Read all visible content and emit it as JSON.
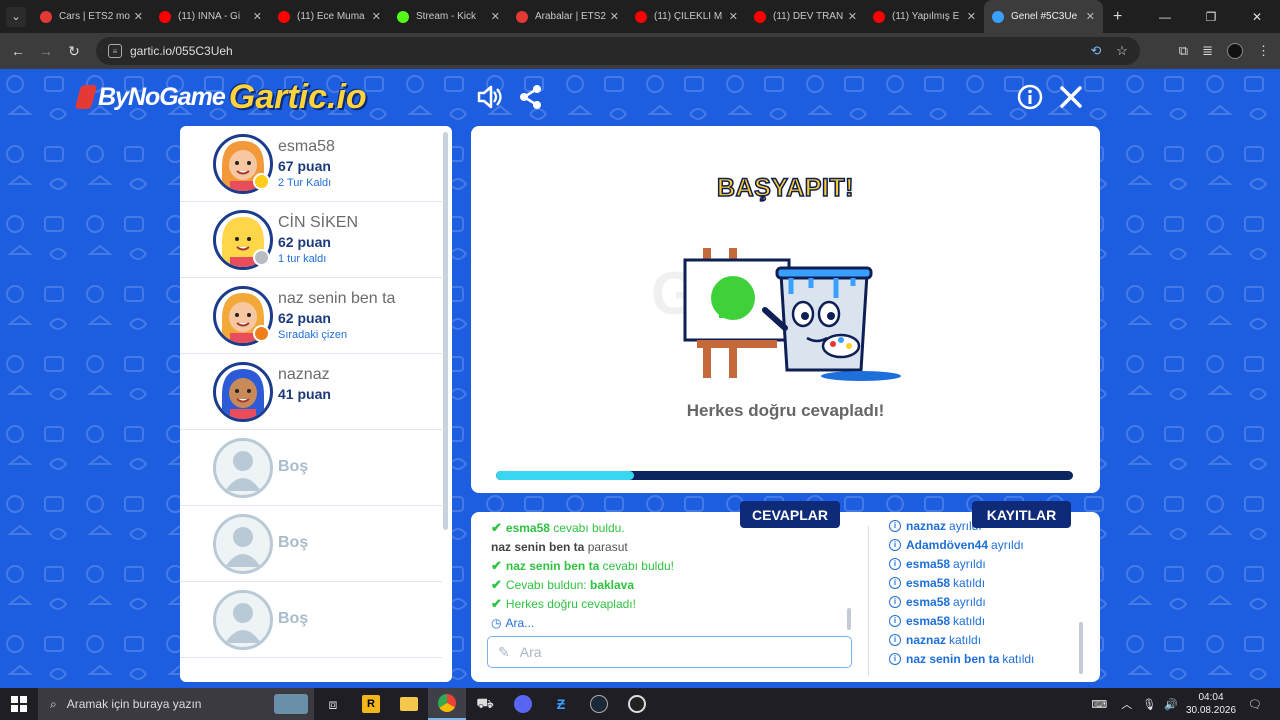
{
  "browser": {
    "tabs": [
      {
        "title": "Cars | ETS2 mo",
        "color": "#e53935"
      },
      {
        "title": "(11) INNA - Gi",
        "color": "#ff0000"
      },
      {
        "title": "(11) Ece Muma",
        "color": "#ff0000"
      },
      {
        "title": "Stream - Kick",
        "color": "#53fc18"
      },
      {
        "title": "Arabalar | ETS2",
        "color": "#e53935"
      },
      {
        "title": "(11) ÇİLEKLİ M",
        "color": "#ff0000"
      },
      {
        "title": "(11) DEV TRAN",
        "color": "#ff0000"
      },
      {
        "title": "(11) Yapılmış E",
        "color": "#ff0000"
      },
      {
        "title": "Genel #5C3Ue",
        "color": "#3aa0ff",
        "active": true
      }
    ],
    "url": "gartic.io/055C3Ueh"
  },
  "game": {
    "logo_bng": "ByNoGame",
    "logo_gartic": "Gartic.io",
    "players": [
      {
        "name": "esma58",
        "points": "67 puan",
        "status": "2 Tur Kaldı",
        "dot": "#ffcc1a",
        "skin": "#f6c7a0",
        "hair": "#f29a3a"
      },
      {
        "name": "CİN SİKEN",
        "points": "62 puan",
        "status": "1 tur kaldı",
        "dot": "#b8bcc2",
        "skin": "#ffd54a",
        "hair": "#ffd54a"
      },
      {
        "name": "naz senin ben ta",
        "points": "62 puan",
        "status": "Sıradaki çizen",
        "dot": "#f07f1a",
        "skin": "#f6c7a0",
        "hair": "#f2a93a"
      },
      {
        "name": "naznaz",
        "points": "41 puan",
        "status": "",
        "dot": "",
        "skin": "#c98a5a",
        "hair": "#2d5bd8"
      },
      {
        "name": "Boş",
        "empty": true
      },
      {
        "name": "Boş",
        "empty": true
      },
      {
        "name": "Boş",
        "empty": true
      }
    ],
    "result_title": "BAŞYAPIT!",
    "result_text": "Herkes doğru cevapladı!",
    "progress": 0.24,
    "answers_tab": "CEVAPLAR",
    "logs_tab": "KAYITLAR",
    "answers": [
      {
        "type": "green",
        "name": "esma58",
        "text": "cevabı buldu."
      },
      {
        "type": "plain",
        "name": "naz senin ben ta",
        "text": "parasut"
      },
      {
        "type": "green",
        "name": "naz senin ben ta",
        "text": "cevabı buldu!"
      },
      {
        "type": "green",
        "name": "Cevabı buldun:",
        "text": "baklava"
      },
      {
        "type": "green",
        "name": "",
        "text": "Herkes doğru cevapladı!"
      },
      {
        "type": "clock",
        "name": "",
        "text": "Ara..."
      }
    ],
    "answer_placeholder": "Ara",
    "logs": [
      {
        "name": "naznaz",
        "action": "ayrıldı"
      },
      {
        "name": "Adamdöven44",
        "action": "ayrıldı"
      },
      {
        "name": "esma58",
        "action": "ayrıldı"
      },
      {
        "name": "esma58",
        "action": "katıldı"
      },
      {
        "name": "esma58",
        "action": "ayrıldı"
      },
      {
        "name": "esma58",
        "action": "katıldı"
      },
      {
        "name": "naznaz",
        "action": "katıldı"
      },
      {
        "name": "naz senin ben ta",
        "action": "katıldı"
      }
    ]
  },
  "taskbar": {
    "search_placeholder": "Aramak için buraya yazın",
    "time": "04:04",
    "date": "30.08.2026"
  }
}
